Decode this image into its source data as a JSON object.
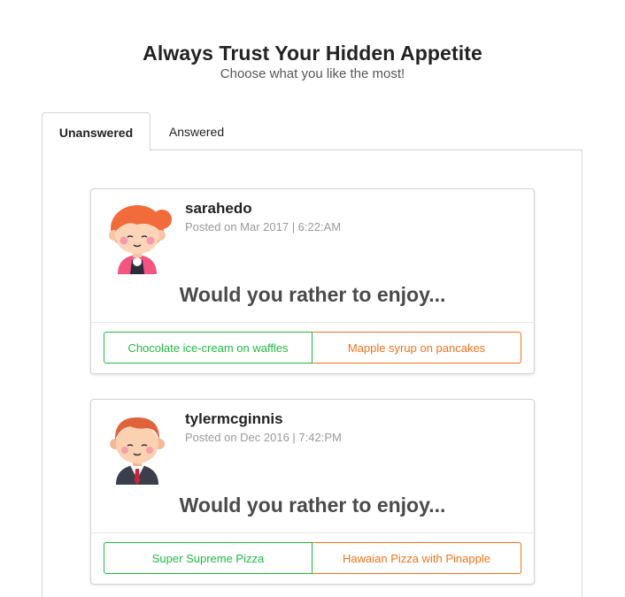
{
  "header": {
    "title": "Always Trust Your Hidden Appetite",
    "subtitle": "Choose what you like the most!"
  },
  "tabs": [
    {
      "label": "Unanswered",
      "active": true
    },
    {
      "label": "Answered",
      "active": false
    }
  ],
  "questions": [
    {
      "author": "sarahedo",
      "avatar": "girl-avatar-icon",
      "posted": "Posted on Mar 2017 | 6:22:AM",
      "prompt": "Would you rather to enjoy...",
      "option_one": "Chocolate ice-cream on waffles",
      "option_two": "Mapple syrup on pancakes"
    },
    {
      "author": "tylermcginnis",
      "avatar": "boy-avatar-icon",
      "posted": "Posted on Dec 2016 | 7:42:PM",
      "prompt": "Would you rather to enjoy...",
      "option_one": "Super Supreme Pizza",
      "option_two": "Hawaian Pizza with Pinapple"
    }
  ],
  "colors": {
    "option_one": "#21ba45",
    "option_two": "#f2711c"
  }
}
